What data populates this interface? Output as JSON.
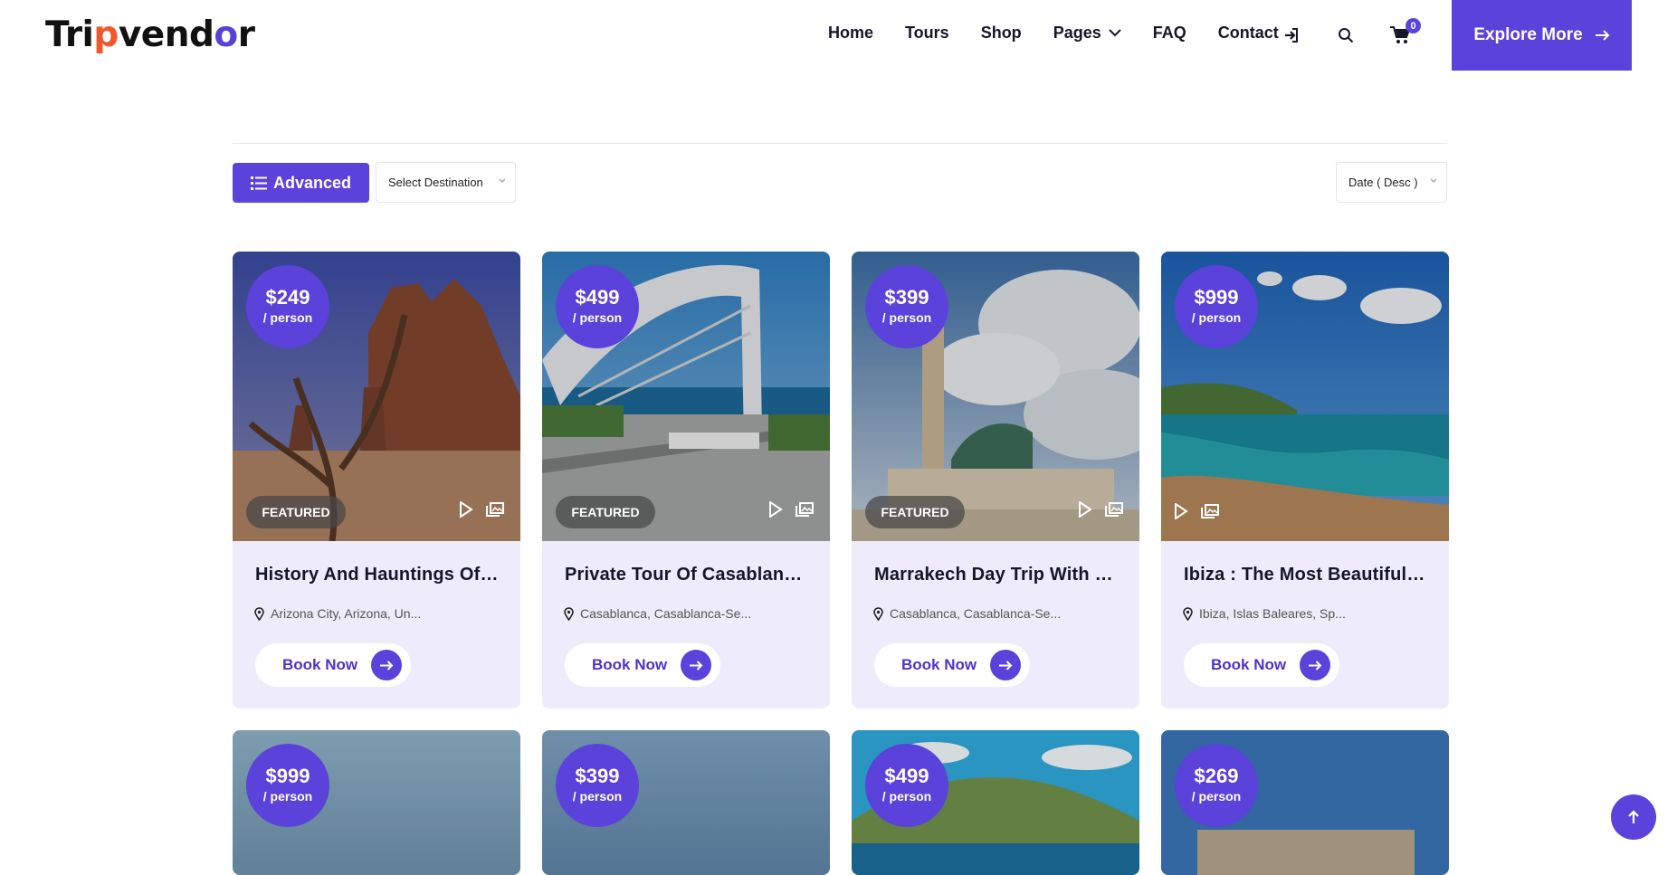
{
  "brand": {
    "logo_text_a": "Tri",
    "logo_text_b": "p",
    "logo_text_c": "vend",
    "logo_text_d": "o",
    "logo_text_e": "r",
    "accent": "#5b42db"
  },
  "nav": {
    "items": [
      "Home",
      "Tours",
      "Shop",
      "Pages",
      "FAQ",
      "Contact"
    ],
    "cart_count": "0",
    "explore_label": "Explore More"
  },
  "filters": {
    "advanced_label": "Advanced",
    "destination_value": "Select Destination",
    "sort_value": "Date ( Desc )"
  },
  "tours": [
    {
      "price": "$249",
      "per": "/ person",
      "featured": "FEATURED",
      "title": "History And Hauntings Of Salem Guided Walking Tour",
      "location": "Arizona City, Arizona, Un..."
    },
    {
      "price": "$499",
      "per": "/ person",
      "featured": "FEATURED",
      "title": "Private Tour Of Casablanca And Hassan II Mosque",
      "location": "Casablanca, Casablanca-Se..."
    },
    {
      "price": "$399",
      "per": "/ person",
      "featured": "FEATURED",
      "title": "Marrakech Day Trip With Camel Ride",
      "location": "Casablanca, Casablanca-Se..."
    },
    {
      "price": "$999",
      "per": "/ person",
      "featured": "",
      "title": "Ibiza : The Most Beautiful Beaches Tour",
      "location": "Ibiza, Islas Baleares, Sp..."
    },
    {
      "price": "$999",
      "per": "/ person"
    },
    {
      "price": "$399",
      "per": "/ person"
    },
    {
      "price": "$499",
      "per": "/ person"
    },
    {
      "price": "$269",
      "per": "/ person"
    }
  ],
  "book_label": "Book Now"
}
